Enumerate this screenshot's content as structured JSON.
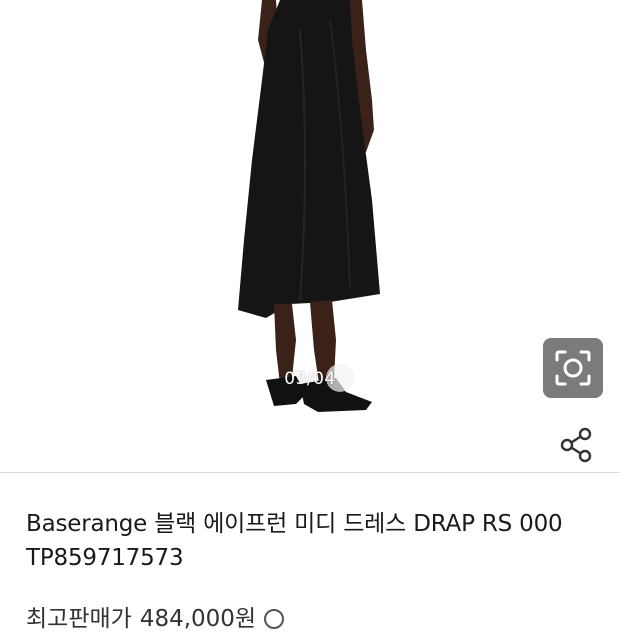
{
  "gallery": {
    "page_indicator": "03/04"
  },
  "product": {
    "title_line1": "Baserange 블랙 에이프런 미디 드레스 DRAP RS 000",
    "title_line2": "TP859717573"
  },
  "price": {
    "label": "최고판매가",
    "value": "484,000원"
  },
  "icons": {
    "lens": "camera-lens-icon",
    "share": "share-icon",
    "info": "info-icon"
  }
}
